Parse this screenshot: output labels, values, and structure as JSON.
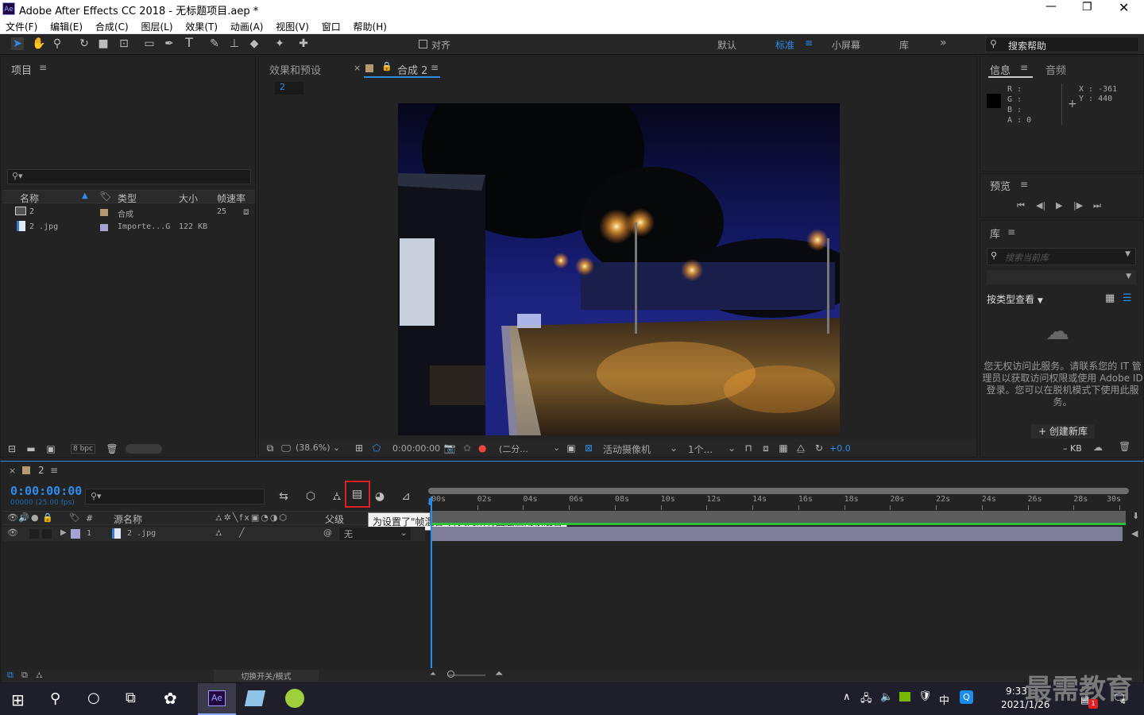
{
  "window": {
    "title": "Adobe After Effects CC 2018 - 无标题项目.aep *",
    "app_badge": "Ae"
  },
  "menu": [
    "文件(F)",
    "编辑(E)",
    "合成(C)",
    "图层(L)",
    "效果(T)",
    "动画(A)",
    "视图(V)",
    "窗口",
    "帮助(H)"
  ],
  "toolbar": {
    "snap_label": "对齐",
    "workspaces": [
      "默认",
      "标准",
      "小屏幕",
      "库"
    ],
    "active_workspace": "标准",
    "search_help": "搜索帮助"
  },
  "project": {
    "title": "项目",
    "columns": [
      "名称",
      "类型",
      "大小",
      "帧速率"
    ],
    "items": [
      {
        "name": "2",
        "type": "合成",
        "size": "",
        "fps": "25",
        "color": "#b49a72"
      },
      {
        "name": "2 .jpg",
        "type": "Importe...G",
        "size": "122 KB",
        "fps": "",
        "color": "#a7a2d4"
      }
    ],
    "bpc": "8 bpc"
  },
  "comp_viewer": {
    "tabs": [
      "效果和预设",
      "合成 2"
    ],
    "sub_tab": "2",
    "zoom": "(38.6%)",
    "timecode": "0:00:00:00",
    "resolution": "(二分...",
    "camera": "活动摄像机",
    "views": "1个...",
    "exposure": "+0.0"
  },
  "info": {
    "tabs": [
      "信息",
      "音频"
    ],
    "r": "R :",
    "g": "G :",
    "b": "B :",
    "a": "A : 0",
    "x": "X : -361",
    "y": "Y : 440"
  },
  "preview": {
    "title": "预览"
  },
  "library": {
    "title": "库",
    "search_placeholder": "搜索当前库",
    "view_by": "按类型查看",
    "message": "您无权访问此服务。请联系您的 IT 管理员以获取访问权限或使用 Adobe ID 登录。您可以在脱机模式下使用此服务。",
    "create_button": "+ 创建新库",
    "kb": "– KB"
  },
  "timeline": {
    "tab": "2",
    "timecode": "0:00:00:00",
    "frames": "00000 (25.00 fps)",
    "col_num": "#",
    "col_source": "源名称",
    "col_parent": "父级",
    "layer": {
      "index": "1",
      "name": "2 .jpg",
      "parent": "无"
    },
    "tooltip": "为设置了\"帧混合\"开关的所有图层启用帧混合",
    "ticks": [
      "00s",
      "02s",
      "04s",
      "06s",
      "08s",
      "10s",
      "12s",
      "14s",
      "16s",
      "18s",
      "20s",
      "22s",
      "24s",
      "26s",
      "28s",
      "30s"
    ],
    "toggle_modes": "切换开关/模式"
  },
  "taskbar": {
    "time": "9:33",
    "date": "2021/1/26",
    "ime": "中",
    "notify": "4",
    "badge": "1",
    "watermark": "最需教育"
  }
}
